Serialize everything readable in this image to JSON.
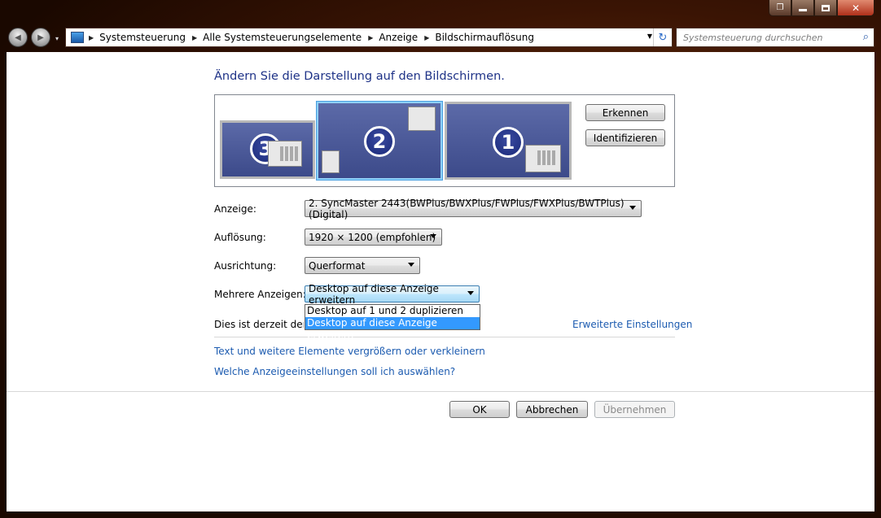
{
  "window": {
    "caption": {
      "min": "–",
      "max": "□",
      "close": "✕"
    }
  },
  "nav": {
    "back_icon": "◀",
    "forward_icon": "▶",
    "recent_icon": "▾",
    "breadcrumb": [
      "Systemsteuerung",
      "Alle Systemsteuerungselemente",
      "Anzeige",
      "Bildschirmauflösung"
    ],
    "crumb_sep": "▶",
    "dropdown_icon": "▼",
    "refresh_icon": "↻",
    "search_placeholder": "Systemsteuerung durchsuchen",
    "search_icon": "⌕"
  },
  "main": {
    "heading": "Ändern Sie die Darstellung auf den Bildschirmen.",
    "monitors": [
      {
        "number": "3",
        "selected": false
      },
      {
        "number": "2",
        "selected": true
      },
      {
        "number": "1",
        "selected": false
      }
    ],
    "detect_button": "Erkennen",
    "identify_button": "Identifizieren",
    "display_label": "Anzeige:",
    "display_value": "2. SyncMaster 2443(BWPlus/BWXPlus/FWPlus/FWXPlus/BWTPlus)(Digital)",
    "resolution_label": "Auflösung:",
    "resolution_value": "1920 × 1200 (empfohlen)",
    "orientation_label": "Ausrichtung:",
    "orientation_value": "Querformat",
    "multi_label": "Mehrere Anzeigen:",
    "multi_value": "Desktop auf diese Anzeige erweitern",
    "multi_options": [
      "Desktop auf 1 und 2 duplizieren",
      "Desktop auf diese Anzeige erweitern"
    ],
    "current_text": "Dies ist derzeit der Ha",
    "advanced_link": "Erweiterte Einstellungen",
    "link_text_size": "Text und weitere Elemente vergrößern oder verkleinern",
    "link_which": "Welche Anzeigeeinstellungen soll ich auswählen?"
  },
  "footer": {
    "ok": "OK",
    "cancel": "Abbrechen",
    "apply": "Übernehmen"
  },
  "colors": {
    "heading": "#1e3287",
    "link": "#1c5bb0",
    "highlight": "#3399ff"
  }
}
